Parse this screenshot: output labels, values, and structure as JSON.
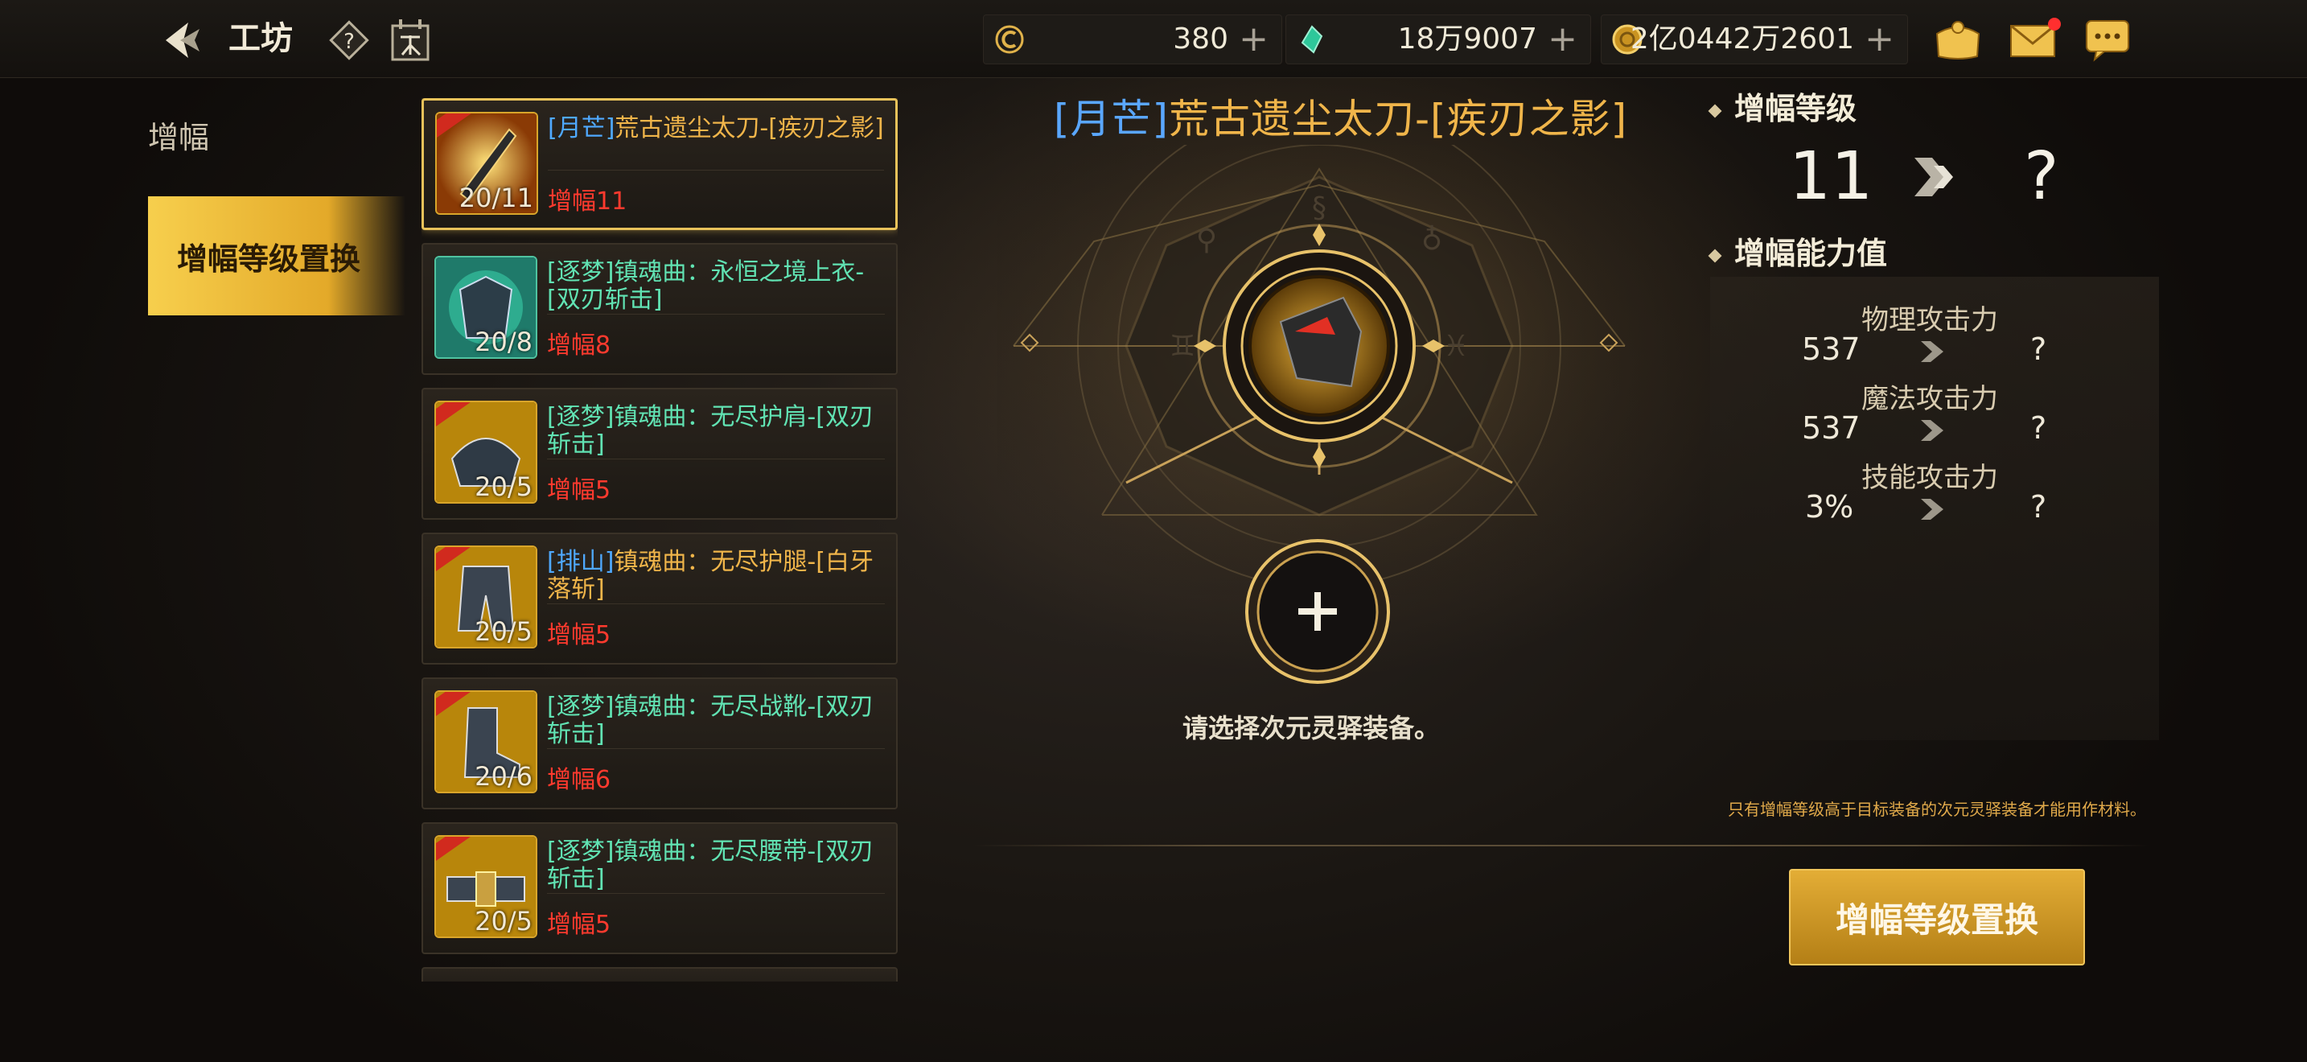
{
  "header": {
    "title": "工坊"
  },
  "currencies": [
    {
      "icon": "coupon-c-icon",
      "value": "380"
    },
    {
      "icon": "crystal-icon",
      "value": "18万9007"
    },
    {
      "icon": "gold-coin-icon",
      "value": "2亿0442万2601"
    }
  ],
  "nav": {
    "item1": "增幅",
    "item2": "增幅等级置换"
  },
  "list": [
    {
      "prefix": "[月芒]",
      "name": "荒古遗尘太刀-[疾刃之影]",
      "level": "增幅11",
      "grade": "20/11",
      "tag": "专属"
    },
    {
      "prefix": "[逐梦]",
      "name": "镇魂曲：永恒之境上衣-[双刃斩击]",
      "level": "增幅8",
      "grade": "20/8",
      "tag": ""
    },
    {
      "prefix": "[逐梦]",
      "name": "镇魂曲：无尽护肩-[双刃斩击]",
      "level": "增幅5",
      "grade": "20/5",
      "tag": "专属"
    },
    {
      "prefix": "[排山]",
      "name": "镇魂曲：无尽护腿-[白牙落斩]",
      "level": "增幅5",
      "grade": "20/5",
      "tag": "专属"
    },
    {
      "prefix": "[逐梦]",
      "name": "镇魂曲：无尽战靴-[双刃斩击]",
      "level": "增幅6",
      "grade": "20/6",
      "tag": "专属"
    },
    {
      "prefix": "[逐梦]",
      "name": "镇魂曲：无尽腰带-[双刃斩击]",
      "level": "增幅5",
      "grade": "20/5",
      "tag": "专属"
    }
  ],
  "center": {
    "title_prefix": "[月芒]",
    "title_name": "荒古遗尘太刀-[疾刃之影]",
    "hint": "请选择次元灵驿装备。"
  },
  "right": {
    "level_title": "增幅等级",
    "level_from": "11",
    "level_to": "?",
    "ability_title": "增幅能力值",
    "stats": [
      {
        "label": "物理攻击力",
        "value": "537",
        "next": "?"
      },
      {
        "label": "魔法攻击力",
        "value": "537",
        "next": "?"
      },
      {
        "label": "技能攻击力",
        "value": "3%",
        "next": "?"
      }
    ],
    "note": "只有增幅等级高于目标装备的次元灵驿装备才能用作材料。",
    "button": "增幅等级置换"
  }
}
